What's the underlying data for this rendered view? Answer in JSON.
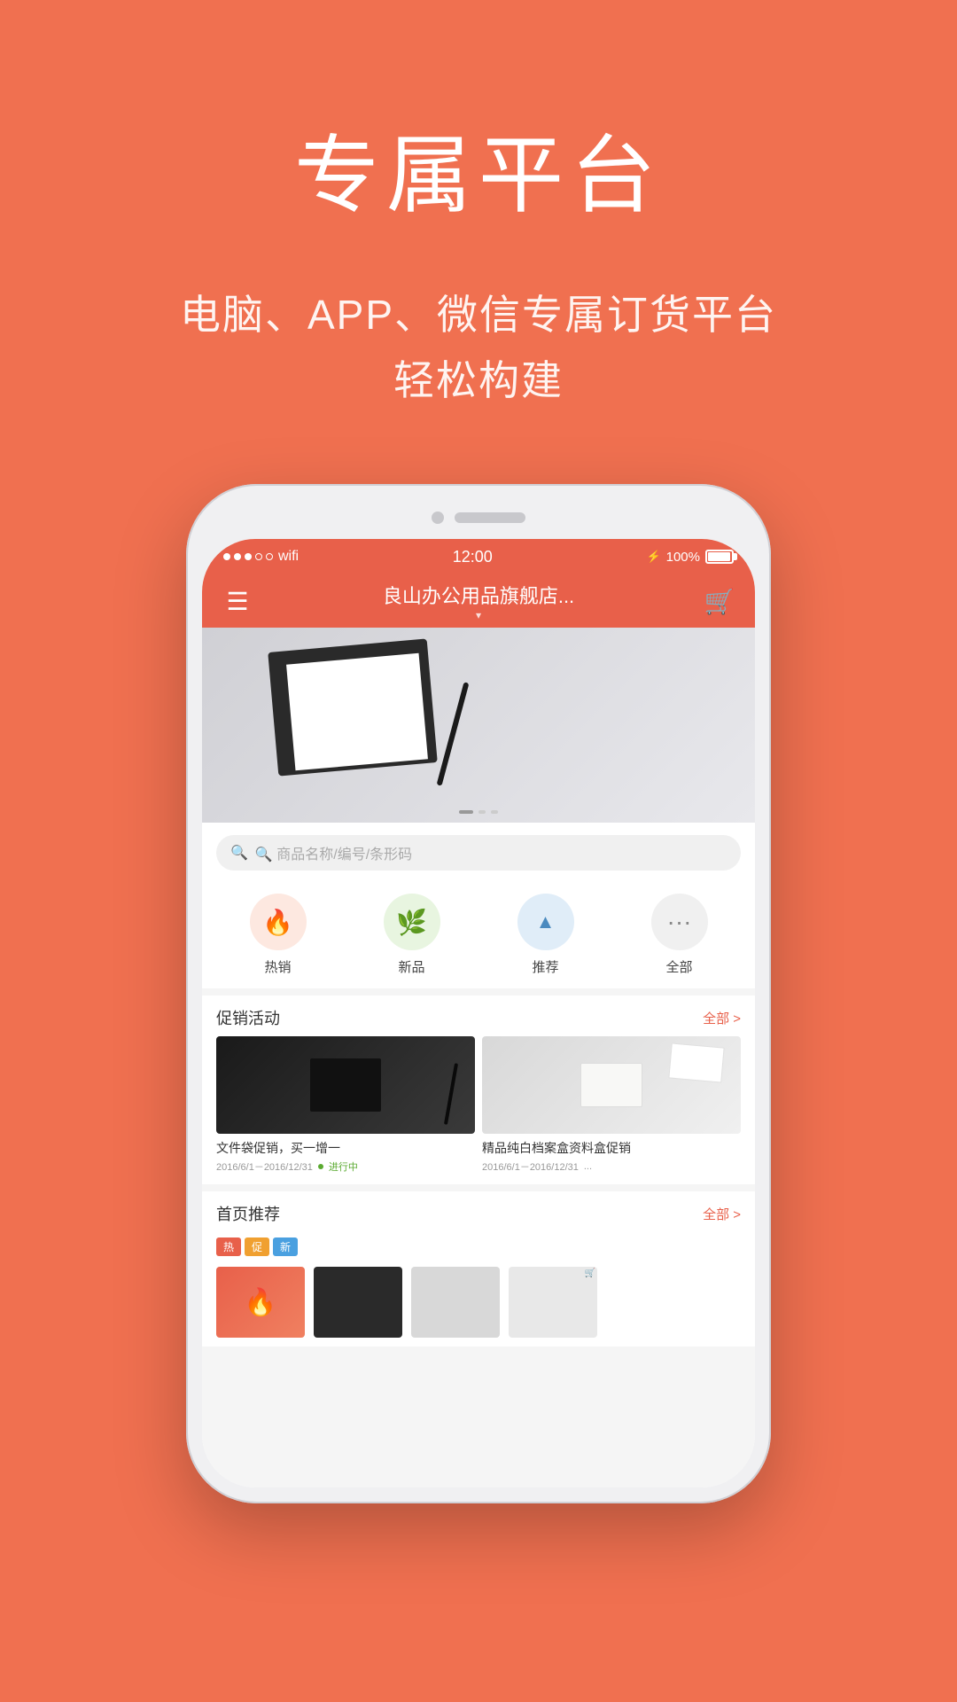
{
  "hero": {
    "title": "专属平台",
    "subtitle_line1": "电脑、APP、微信专属订货平台",
    "subtitle_line2": "轻松构建"
  },
  "status_bar": {
    "time": "12:00",
    "battery": "100%",
    "signal_dots": [
      "filled",
      "filled",
      "filled",
      "empty",
      "empty"
    ]
  },
  "nav": {
    "store_name": "良山办公用品旗舰店...",
    "menu_icon": "≡",
    "cart_icon": "🛒"
  },
  "search": {
    "placeholder": "🔍 商品名称/编号/条形码"
  },
  "categories": [
    {
      "id": "hot",
      "label": "热销",
      "icon": "🔥",
      "style": "hot"
    },
    {
      "id": "new",
      "label": "新品",
      "icon": "🌿",
      "style": "new"
    },
    {
      "id": "recommend",
      "label": "推荐",
      "icon": "▲",
      "style": "recommend"
    },
    {
      "id": "all",
      "label": "全部",
      "icon": "···",
      "style": "all"
    }
  ],
  "promotions": {
    "section_title": "促销活动",
    "more_label": "全部 >",
    "items": [
      {
        "name": "文件袋促销，买一增一",
        "date": "2016/6/1－2016/12/31",
        "status": "进行中"
      },
      {
        "name": "精品纯白档案盒资料盒促销",
        "date": "2016/6/1－2016/12/31",
        "status": "..."
      }
    ]
  },
  "recommendations": {
    "section_title": "首页推荐",
    "more_label": "全部 >",
    "tags": [
      "热",
      "促",
      "新"
    ]
  },
  "colors": {
    "primary": "#E8604A",
    "background": "#F07050",
    "green": "#5aaa30",
    "blue": "#4a8abf"
  }
}
